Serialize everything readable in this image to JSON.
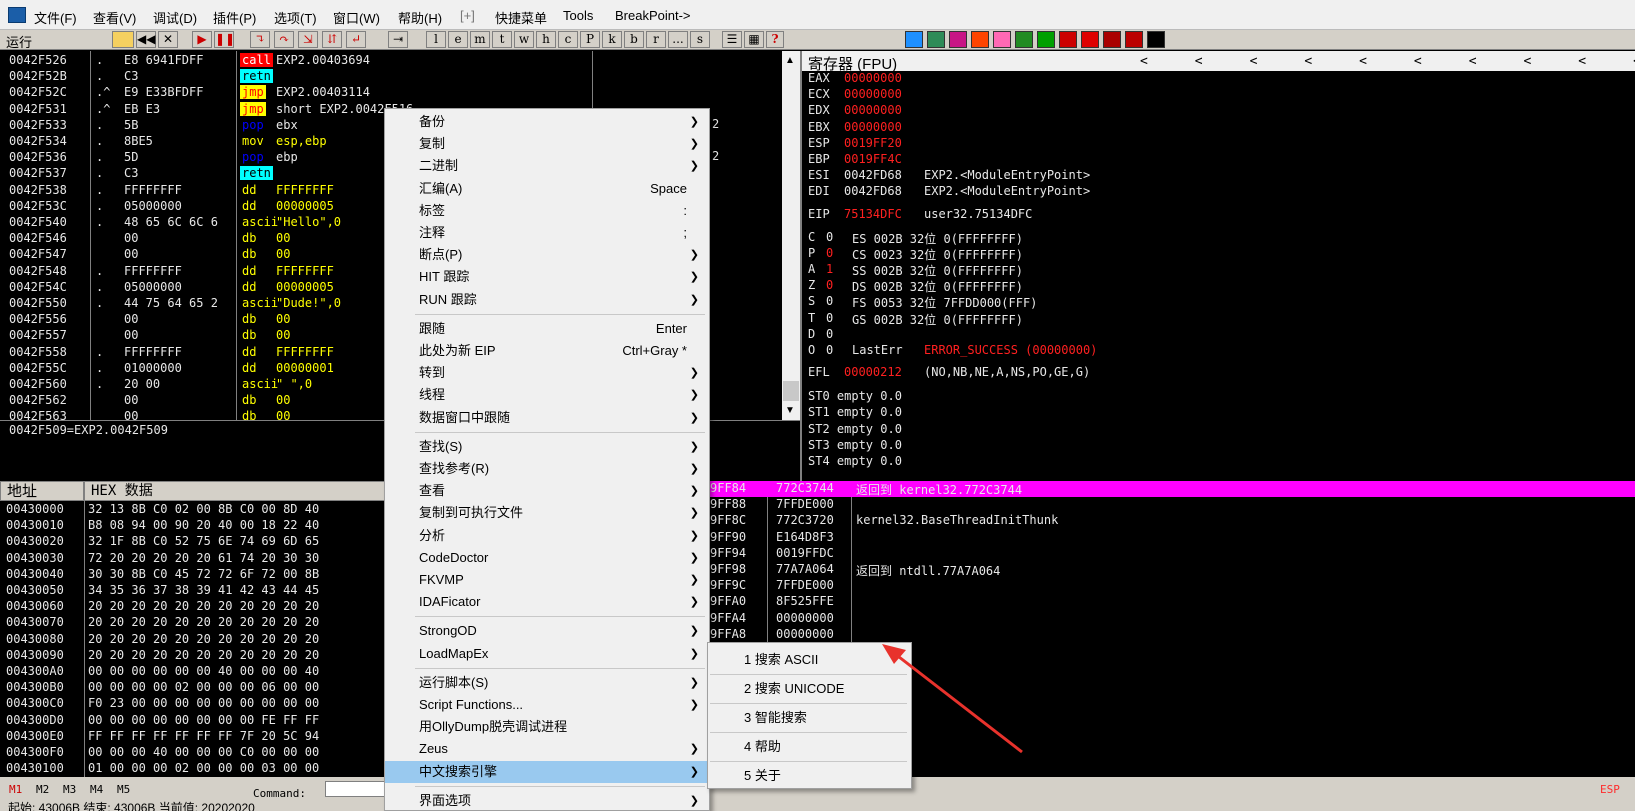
{
  "menu": {
    "items": [
      "文件(F)",
      "查看(V)",
      "调试(D)",
      "插件(P)",
      "选项(T)",
      "窗口(W)",
      "帮助(H)",
      "[+]",
      "快捷菜单",
      "Tools",
      "BreakPoint->"
    ]
  },
  "toolbar": {
    "status": "运行",
    "buttons": [
      "l",
      "e",
      "m",
      "t",
      "w",
      "h",
      "c",
      "P",
      "k",
      "b",
      "r",
      "...",
      "s"
    ],
    "colors": [
      "#1e90ff",
      "#2e8b57",
      "#c71585",
      "#ff4500",
      "#ff69b4",
      "#228b22",
      "#00a000",
      "#cc0000",
      "#dd0000",
      "#aa0000",
      "#bb0000",
      "#000000"
    ]
  },
  "disasm": {
    "rows": [
      {
        "addr": "0042F526",
        "mark": ".",
        "hex": "E8 6941FDFF",
        "op": "call",
        "arg": "EXP2.00403694",
        "tc": "#ff0000",
        "tf": "#ffffff"
      },
      {
        "addr": "0042F52B",
        "mark": ".",
        "hex": "C3",
        "op": "retn",
        "arg": "",
        "tc": "#00ffff",
        "tf": "#000000"
      },
      {
        "addr": "0042F52C",
        "mark": ".^",
        "hex": "E9 E33BFDFF",
        "op": "jmp",
        "arg": "EXP2.00403114",
        "tc": "#ffff00",
        "tf": "#ff0000"
      },
      {
        "addr": "0042F531",
        "mark": ".^",
        "hex": "EB E3",
        "op": "jmp",
        "arg": "short EXP2.0042F516",
        "tc": "#ffff00",
        "tf": "#ff0000"
      },
      {
        "addr": "0042F533",
        "mark": ".",
        "hex": "5B",
        "op": "pop",
        "arg": "ebx",
        "tc": "",
        "tf": "#0000ff"
      },
      {
        "addr": "0042F534",
        "mark": ".",
        "hex": "8BE5",
        "op": "mov",
        "arg": "esp,ebp",
        "tc": "",
        "tf": "#ffff00"
      },
      {
        "addr": "0042F536",
        "mark": ".",
        "hex": "5D",
        "op": "pop",
        "arg": "ebp",
        "tc": "",
        "tf": "#0000ff"
      },
      {
        "addr": "0042F537",
        "mark": ".",
        "hex": "C3",
        "op": "retn",
        "arg": "",
        "tc": "#00ffff",
        "tf": "#000000"
      },
      {
        "addr": "0042F538",
        "mark": ".",
        "hex": "FFFFFFFF",
        "op": "dd",
        "arg": "FFFFFFFF",
        "tc": "",
        "tf": "#ffff00"
      },
      {
        "addr": "0042F53C",
        "mark": ".",
        "hex": "05000000",
        "op": "dd",
        "arg": "00000005",
        "tc": "",
        "tf": "#ffff00"
      },
      {
        "addr": "0042F540",
        "mark": ".",
        "hex": "48 65 6C 6C 6",
        "op": "ascii",
        "arg": "\"Hello\",0",
        "tc": "",
        "tf": "#ffff00"
      },
      {
        "addr": "0042F546",
        "mark": "",
        "hex": "00",
        "op": "db",
        "arg": "00",
        "tc": "",
        "tf": "#ffff00"
      },
      {
        "addr": "0042F547",
        "mark": "",
        "hex": "00",
        "op": "db",
        "arg": "00",
        "tc": "",
        "tf": "#ffff00"
      },
      {
        "addr": "0042F548",
        "mark": ".",
        "hex": "FFFFFFFF",
        "op": "dd",
        "arg": "FFFFFFFF",
        "tc": "",
        "tf": "#ffff00"
      },
      {
        "addr": "0042F54C",
        "mark": ".",
        "hex": "05000000",
        "op": "dd",
        "arg": "00000005",
        "tc": "",
        "tf": "#ffff00"
      },
      {
        "addr": "0042F550",
        "mark": ".",
        "hex": "44 75 64 65 2",
        "op": "ascii",
        "arg": "\"Dude!\",0",
        "tc": "",
        "tf": "#ffff00"
      },
      {
        "addr": "0042F556",
        "mark": "",
        "hex": "00",
        "op": "db",
        "arg": "00",
        "tc": "",
        "tf": "#ffff00"
      },
      {
        "addr": "0042F557",
        "mark": "",
        "hex": "00",
        "op": "db",
        "arg": "00",
        "tc": "",
        "tf": "#ffff00"
      },
      {
        "addr": "0042F558",
        "mark": ".",
        "hex": "FFFFFFFF",
        "op": "dd",
        "arg": "FFFFFFFF",
        "tc": "",
        "tf": "#ffff00"
      },
      {
        "addr": "0042F55C",
        "mark": ".",
        "hex": "01000000",
        "op": "dd",
        "arg": "00000001",
        "tc": "",
        "tf": "#ffff00"
      },
      {
        "addr": "0042F560",
        "mark": ".",
        "hex": "20 00",
        "op": "ascii",
        "arg": "\" \",0",
        "tc": "",
        "tf": "#ffff00"
      },
      {
        "addr": "0042F562",
        "mark": "",
        "hex": "00",
        "op": "db",
        "arg": "00",
        "tc": "",
        "tf": "#ffff00"
      },
      {
        "addr": "0042F563",
        "mark": "",
        "hex": "00",
        "op": "db",
        "arg": "00",
        "tc": "",
        "tf": "#ffff00"
      }
    ],
    "info": "0042F509=EXP2.0042F509",
    "right_frag1": "2",
    "right_frag2": "2"
  },
  "registers": {
    "title": "寄存器 (FPU)",
    "arrows": "<      <      <      <      <      <      <      <      <      <      <",
    "regs": [
      {
        "n": "EAX",
        "v": "00000000",
        "c": "#ff2020",
        "t": ""
      },
      {
        "n": "ECX",
        "v": "00000000",
        "c": "#ff2020",
        "t": ""
      },
      {
        "n": "EDX",
        "v": "00000000",
        "c": "#ff2020",
        "t": ""
      },
      {
        "n": "EBX",
        "v": "00000000",
        "c": "#ff2020",
        "t": ""
      },
      {
        "n": "ESP",
        "v": "0019FF20",
        "c": "#ff2020",
        "t": ""
      },
      {
        "n": "EBP",
        "v": "0019FF4C",
        "c": "#ff2020",
        "t": ""
      },
      {
        "n": "ESI",
        "v": "0042FD68",
        "c": "#e8e8e8",
        "t": "EXP2.<ModuleEntryPoint>"
      },
      {
        "n": "EDI",
        "v": "0042FD68",
        "c": "#e8e8e8",
        "t": "EXP2.<ModuleEntryPoint>"
      }
    ],
    "eip": {
      "n": "EIP",
      "v": "75134DFC",
      "t": "user32.75134DFC"
    },
    "flags": [
      {
        "f": "C",
        "b": "0",
        "bc": "#e8e8e8",
        "s": "ES 002B 32位 0(FFFFFFFF)"
      },
      {
        "f": "P",
        "b": "0",
        "bc": "#ff2020",
        "s": "CS 0023 32位 0(FFFFFFFF)"
      },
      {
        "f": "A",
        "b": "1",
        "bc": "#ff2020",
        "s": "SS 002B 32位 0(FFFFFFFF)"
      },
      {
        "f": "Z",
        "b": "0",
        "bc": "#ff2020",
        "s": "DS 002B 32位 0(FFFFFFFF)"
      },
      {
        "f": "S",
        "b": "0",
        "bc": "#e8e8e8",
        "s": "FS 0053 32位 7FFDD000(FFF)"
      },
      {
        "f": "T",
        "b": "0",
        "bc": "#e8e8e8",
        "s": "GS 002B 32位 0(FFFFFFFF)"
      },
      {
        "f": "D",
        "b": "0",
        "bc": "#e8e8e8",
        "s": ""
      },
      {
        "f": "O",
        "b": "0",
        "bc": "#e8e8e8",
        "s": "LastErr"
      }
    ],
    "lasterr": "ERROR_SUCCESS (00000000)",
    "efl": {
      "n": "EFL",
      "v": "00000212",
      "t": "(NO,NB,NE,A,NS,PO,GE,G)"
    },
    "st": [
      "ST0 empty 0.0",
      "ST1 empty 0.0",
      "ST2 empty 0.0",
      "ST3 empty 0.0",
      "ST4 empty 0.0"
    ]
  },
  "dump": {
    "header_addr": "地址",
    "header_hex": "HEX 数据",
    "rows": [
      {
        "a": "00430000",
        "h": "32 13 8B C0 02 00 8B C0 00 8D 40"
      },
      {
        "a": "00430010",
        "h": "B8 08 94 00 90 20 40 00 18 22 40"
      },
      {
        "a": "00430020",
        "h": "32 1F 8B C0 52 75 6E 74 69 6D 65"
      },
      {
        "a": "00430030",
        "h": "72 20 20 20 20 20 61 74 20 30 30"
      },
      {
        "a": "00430040",
        "h": "30 30 8B C0 45 72 72 6F 72 00 8B"
      },
      {
        "a": "00430050",
        "h": "34 35 36 37 38 39 41 42 43 44 45"
      },
      {
        "a": "00430060",
        "h": "20 20 20 20 20 20 20 20 20 20 20"
      },
      {
        "a": "00430070",
        "h": "20 20 20 20 20 20 20 20 20 20 20"
      },
      {
        "a": "00430080",
        "h": "20 20 20 20 20 20 20 20 20 20 20"
      },
      {
        "a": "00430090",
        "h": "20 20 20 20 20 20 20 20 20 20 20"
      },
      {
        "a": "004300A0",
        "h": "00 00 00 00 00 00 40 00 00 00 40"
      },
      {
        "a": "004300B0",
        "h": "00 00 00 00 02 00 00 00 06 00 00"
      },
      {
        "a": "004300C0",
        "h": "F0 23 00 00 00 00 00 00 00 00 00"
      },
      {
        "a": "004300D0",
        "h": "00 00 00 00 00 00 00 00 FE FF FF"
      },
      {
        "a": "004300E0",
        "h": "FF FF FF FF FF FF FF 7F 20 5C 94"
      },
      {
        "a": "004300F0",
        "h": "00 00 00 40 00 00 00 C0 00 00 00"
      },
      {
        "a": "00430100",
        "h": "01 00 00 00 02 00 00 00 03 00 00"
      }
    ]
  },
  "stack": {
    "rows": [
      {
        "a": "9FF84",
        "v": "772C3744",
        "c": "返回到 kernel32.772C3744",
        "hl": true
      },
      {
        "a": "9FF88",
        "v": "7FFDE000",
        "c": "",
        "hl": false
      },
      {
        "a": "9FF8C",
        "v": "772C3720",
        "c": "kernel32.BaseThreadInitThunk",
        "hl": false
      },
      {
        "a": "9FF90",
        "v": "E164D8F3",
        "c": "",
        "hl": false
      },
      {
        "a": "9FF94",
        "v": "0019FFDC",
        "c": "",
        "hl": false
      },
      {
        "a": "9FF98",
        "v": "77A7A064",
        "c": "返回到 ntdll.77A7A064",
        "hl": false
      },
      {
        "a": "9FF9C",
        "v": "7FFDE000",
        "c": "",
        "hl": false
      },
      {
        "a": "9FFA0",
        "v": "8F525FFE",
        "c": "",
        "hl": false
      },
      {
        "a": "9FFA4",
        "v": "00000000",
        "c": "",
        "hl": false
      },
      {
        "a": "9FFA8",
        "v": "00000000",
        "c": "",
        "hl": false
      }
    ]
  },
  "context_menu": {
    "items": [
      {
        "label": "备份",
        "shortcut": "",
        "arrow": true
      },
      {
        "label": "复制",
        "shortcut": "",
        "arrow": true
      },
      {
        "label": "二进制",
        "shortcut": "",
        "arrow": true
      },
      {
        "label": "汇编(A)",
        "shortcut": "Space",
        "arrow": false
      },
      {
        "label": "标签",
        "shortcut": ":",
        "arrow": false
      },
      {
        "label": "注释",
        "shortcut": ";",
        "arrow": false
      },
      {
        "label": "断点(P)",
        "shortcut": "",
        "arrow": true
      },
      {
        "label": "HIT 跟踪",
        "shortcut": "",
        "arrow": true
      },
      {
        "label": "RUN 跟踪",
        "shortcut": "",
        "arrow": true
      },
      {
        "sep": true
      },
      {
        "label": "跟随",
        "shortcut": "Enter",
        "arrow": false
      },
      {
        "label": "此处为新 EIP",
        "shortcut": "Ctrl+Gray *",
        "arrow": false
      },
      {
        "label": "转到",
        "shortcut": "",
        "arrow": true
      },
      {
        "label": "线程",
        "shortcut": "",
        "arrow": true
      },
      {
        "label": "数据窗口中跟随",
        "shortcut": "",
        "arrow": true
      },
      {
        "sep": true
      },
      {
        "label": "查找(S)",
        "shortcut": "",
        "arrow": true
      },
      {
        "label": "查找参考(R)",
        "shortcut": "",
        "arrow": true
      },
      {
        "label": "查看",
        "shortcut": "",
        "arrow": true
      },
      {
        "label": "复制到可执行文件",
        "shortcut": "",
        "arrow": true
      },
      {
        "label": "分析",
        "shortcut": "",
        "arrow": true
      },
      {
        "label": "CodeDoctor",
        "shortcut": "",
        "arrow": true
      },
      {
        "label": "FKVMP",
        "shortcut": "",
        "arrow": true
      },
      {
        "label": "IDAFicator",
        "shortcut": "",
        "arrow": true
      },
      {
        "sep": true
      },
      {
        "label": "StrongOD",
        "shortcut": "",
        "arrow": true
      },
      {
        "label": "LoadMapEx",
        "shortcut": "",
        "arrow": true
      },
      {
        "sep": true
      },
      {
        "label": "运行脚本(S)",
        "shortcut": "",
        "arrow": true
      },
      {
        "label": "Script Functions...",
        "shortcut": "",
        "arrow": true
      },
      {
        "label": "用OllyDump脱壳调试进程",
        "shortcut": "",
        "arrow": false
      },
      {
        "label": "Zeus",
        "shortcut": "",
        "arrow": true
      },
      {
        "label": "中文搜索引擎",
        "shortcut": "",
        "arrow": true,
        "active": true
      },
      {
        "sep": true
      },
      {
        "label": "界面选项",
        "shortcut": "",
        "arrow": true
      }
    ]
  },
  "submenu": {
    "items": [
      "1 搜索 ASCII",
      "2 搜索 UNICODE",
      "3 智能搜索",
      "4 帮助",
      "5 关于"
    ]
  },
  "bottom": {
    "tabs": [
      "M1",
      "M2",
      "M3",
      "M4",
      "M5"
    ],
    "command_label": "Command:",
    "esp": "ESP",
    "status_text": "起始: 43006B 结束: 43006B 当前值: 20202020"
  },
  "colors": {
    "highlight": "#ff00ff",
    "menu_active": "#99c9ef",
    "arrow": "#e8322c"
  }
}
